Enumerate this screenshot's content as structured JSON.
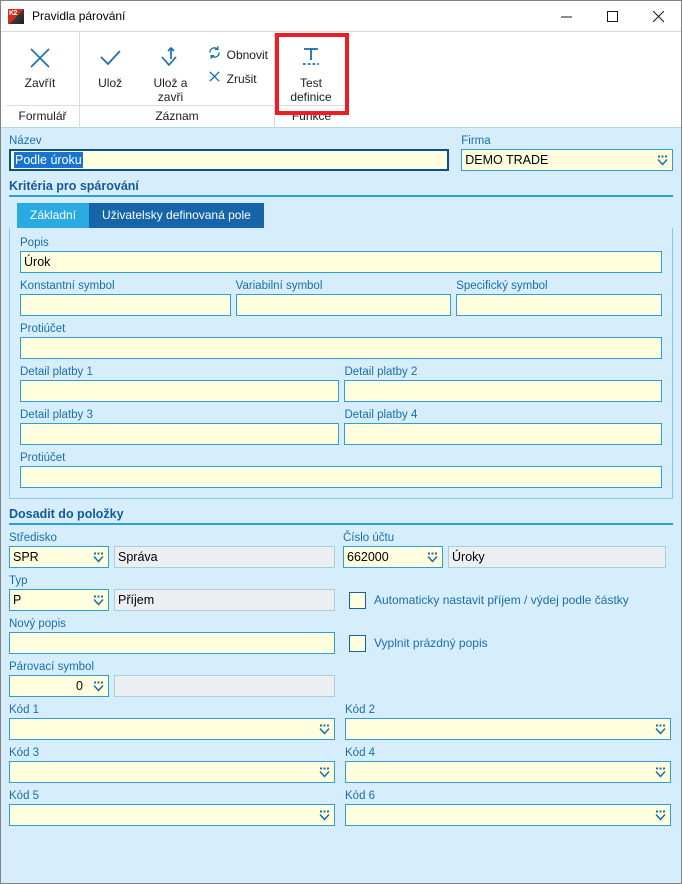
{
  "window": {
    "title": "Pravidla párování",
    "app_icon": "k2-logo-icon",
    "minimize_label": "–",
    "maximize_label": "☐",
    "close_label": "✕"
  },
  "ribbon": {
    "groups": [
      {
        "label": "Formulář",
        "buttons": [
          {
            "label": "Zavřít",
            "icon": "close-x-icon"
          }
        ]
      },
      {
        "label": "Záznam",
        "buttons": [
          {
            "label": "Ulož",
            "icon": "check-icon"
          },
          {
            "label": "Ulož a zavři",
            "label_line1": "Ulož a",
            "label_line2": "zavři",
            "icon": "save-and-close-icon"
          }
        ],
        "small_buttons": [
          {
            "label": "Obnovit",
            "icon": "refresh-icon"
          },
          {
            "label": "Zrušit",
            "icon": "cancel-x-icon"
          }
        ]
      },
      {
        "label": "Funkce",
        "highlighted": true,
        "highlight_color": "#ee1c25",
        "buttons": [
          {
            "label": "Test definice",
            "label_line1": "Test",
            "label_line2": "definice",
            "icon": "test-definition-icon"
          }
        ]
      }
    ]
  },
  "form": {
    "nazev": {
      "label": "Název",
      "value": "Podle úroku",
      "selected": true
    },
    "firma": {
      "label": "Firma",
      "value": "DEMO TRADE"
    },
    "kriteria_section": {
      "title": "Kritéria pro spárování"
    },
    "tabs": [
      {
        "label": "Základní",
        "active": true
      },
      {
        "label": "Uživatelsky definovaná pole",
        "active": false
      }
    ],
    "popis": {
      "label": "Popis",
      "value": "Úrok"
    },
    "konstantni_symbol": {
      "label": "Konstantní symbol",
      "value": ""
    },
    "variabilni_symbol": {
      "label": "Variabilní symbol",
      "value": ""
    },
    "specificky_symbol": {
      "label": "Specifický symbol",
      "value": ""
    },
    "protiucet_1": {
      "label": "Protiúčet",
      "value": ""
    },
    "detail_platby_1": {
      "label": "Detail platby 1",
      "value": ""
    },
    "detail_platby_2": {
      "label": "Detail platby 2",
      "value": ""
    },
    "detail_platby_3": {
      "label": "Detail platby 3",
      "value": ""
    },
    "detail_platby_4": {
      "label": "Detail platby 4",
      "value": ""
    },
    "protiucet_2": {
      "label": "Protiúčet",
      "value": ""
    },
    "dosadit_section": {
      "title": "Dosadit do položky"
    },
    "stredisko": {
      "label": "Středisko",
      "value": "SPR",
      "description": "Správa"
    },
    "cislo_uctu": {
      "label": "Číslo účtu",
      "value": "662000",
      "description": "Úroky"
    },
    "typ": {
      "label": "Typ",
      "value": "P",
      "description": "Příjem"
    },
    "auto_prijem": {
      "label": "Automaticky nastavit příjem / výdej podle částky",
      "checked": false
    },
    "novy_popis": {
      "label": "Nový popis",
      "value": ""
    },
    "vyplnit_prazdny": {
      "label": "Vyplnit prázdný popis",
      "checked": false
    },
    "parovaci_symbol": {
      "label": "Párovací symbol",
      "value": "0",
      "description": ""
    },
    "kod_1": {
      "label": "Kód 1",
      "value": ""
    },
    "kod_2": {
      "label": "Kód 2",
      "value": ""
    },
    "kod_3": {
      "label": "Kód 3",
      "value": ""
    },
    "kod_4": {
      "label": "Kód 4",
      "value": ""
    },
    "kod_5": {
      "label": "Kód 5",
      "value": ""
    },
    "kod_6": {
      "label": "Kód 6",
      "value": ""
    }
  }
}
